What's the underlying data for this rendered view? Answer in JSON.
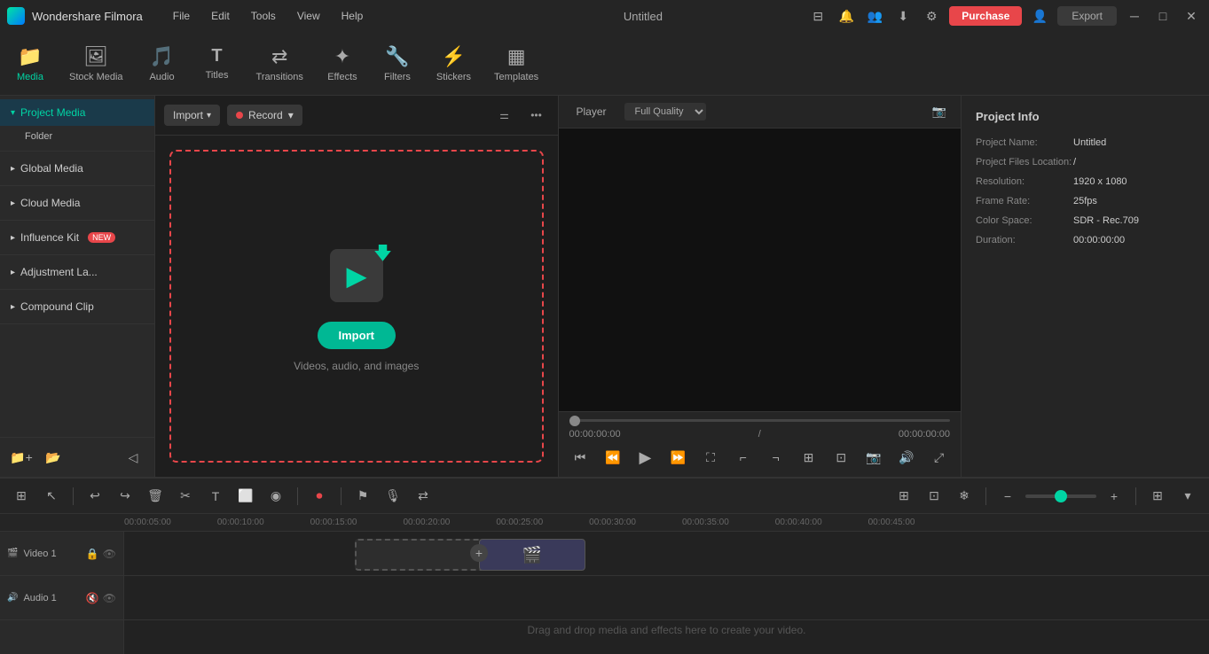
{
  "app": {
    "name": "Wondershare Filmora",
    "title": "Untitled"
  },
  "titlebar": {
    "menu": [
      "File",
      "Edit",
      "Tools",
      "View",
      "Help"
    ],
    "purchase_label": "Purchase",
    "export_label": "Export"
  },
  "toolbar": {
    "items": [
      {
        "id": "media",
        "label": "Media",
        "icon": "🎬",
        "active": true
      },
      {
        "id": "stock-media",
        "label": "Stock Media",
        "icon": "🖼"
      },
      {
        "id": "audio",
        "label": "Audio",
        "icon": "🎵"
      },
      {
        "id": "titles",
        "label": "Titles",
        "icon": "T"
      },
      {
        "id": "transitions",
        "label": "Transitions",
        "icon": "↔"
      },
      {
        "id": "effects",
        "label": "Effects",
        "icon": "✨"
      },
      {
        "id": "filters",
        "label": "Filters",
        "icon": "🔬"
      },
      {
        "id": "stickers",
        "label": "Stickers",
        "icon": "⭐"
      },
      {
        "id": "templates",
        "label": "Templates",
        "icon": "▦"
      }
    ]
  },
  "left_panel": {
    "active_item": "project-media",
    "items": [
      {
        "id": "project-media",
        "label": "Project Media",
        "active": true
      },
      {
        "id": "folder",
        "label": "Folder",
        "indent": true
      },
      {
        "id": "global-media",
        "label": "Global Media"
      },
      {
        "id": "cloud-media",
        "label": "Cloud Media"
      },
      {
        "id": "influence-kit",
        "label": "Influence Kit",
        "badge": "NEW"
      },
      {
        "id": "adjustment-la",
        "label": "Adjustment La..."
      },
      {
        "id": "compound-clip",
        "label": "Compound Clip"
      }
    ]
  },
  "media_panel": {
    "import_label": "Import",
    "record_label": "Record",
    "drop_zone": {
      "import_btn_label": "Import",
      "hint_text": "Videos, audio, and images"
    }
  },
  "player": {
    "tab_label": "Player",
    "quality_label": "Full Quality",
    "time_current": "00:00:00:00",
    "time_total": "00:00:00:00"
  },
  "project_info": {
    "title": "Project Info",
    "fields": [
      {
        "label": "Project Name:",
        "value": "Untitled"
      },
      {
        "label": "Project Files Location:",
        "value": "/"
      },
      {
        "label": "Resolution:",
        "value": "1920 x 1080"
      },
      {
        "label": "Frame Rate:",
        "value": "25fps"
      },
      {
        "label": "Color Space:",
        "value": "SDR - Rec.709"
      },
      {
        "label": "Duration:",
        "value": "00:00:00:00"
      }
    ]
  },
  "timeline": {
    "ruler_marks": [
      "00:00:05:00",
      "00:00:10:00",
      "00:00:15:00",
      "00:00:20:00",
      "00:00:25:00",
      "00:00:30:00",
      "00:00:35:00",
      "00:00:40:00",
      "00:00:45:00"
    ],
    "tracks": [
      {
        "id": "video-1",
        "label": "Video 1"
      },
      {
        "id": "audio-1",
        "label": "Audio 1"
      }
    ],
    "drag_hint": "Drag and drop media and effects here to create your video."
  },
  "window_controls": {
    "minimize": "−",
    "maximize": "□",
    "close": "×"
  }
}
